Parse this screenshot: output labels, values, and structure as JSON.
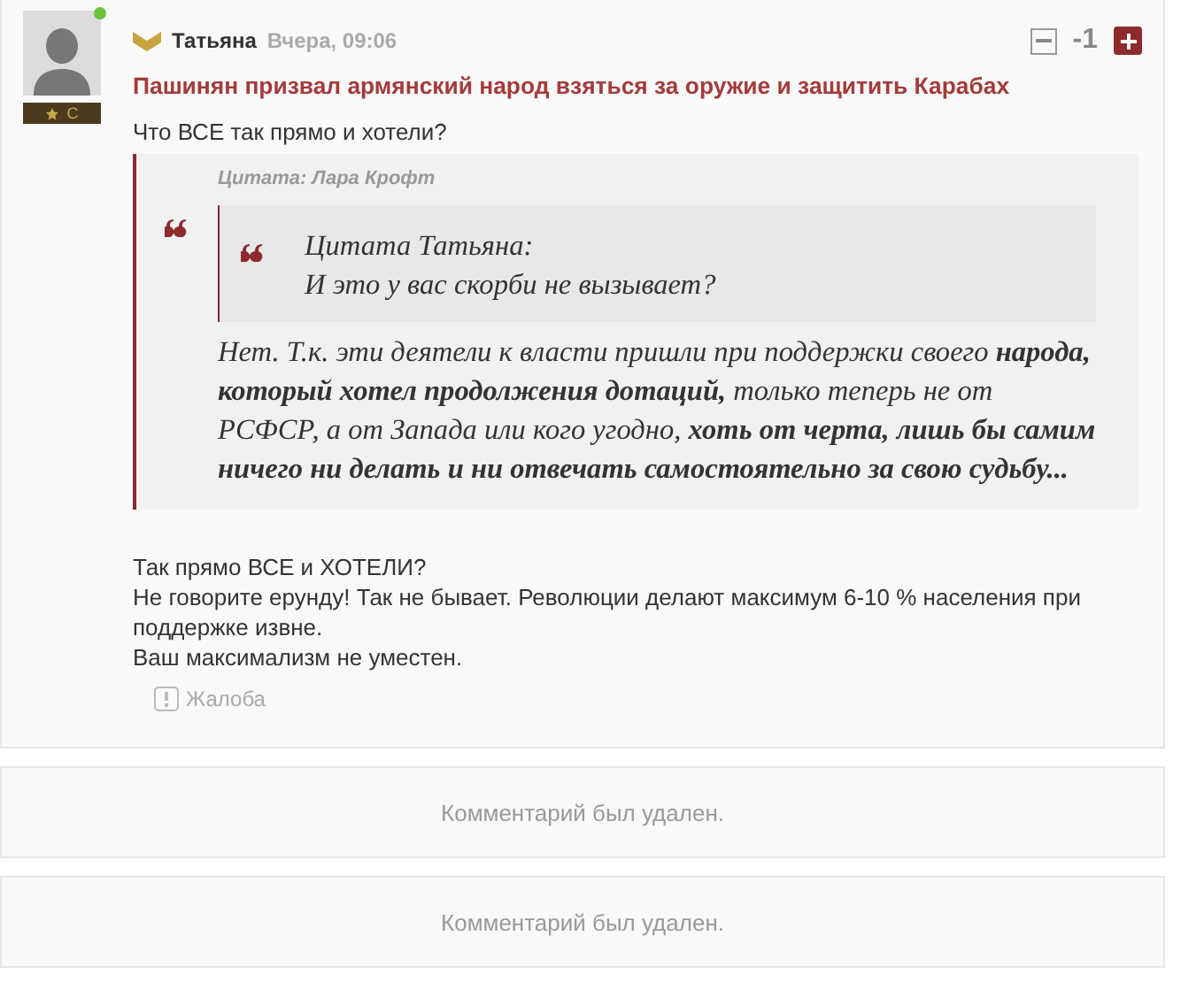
{
  "comment": {
    "author": "Татьяна",
    "time": "Вчера, 09:06",
    "online": true,
    "rank": "C",
    "score": "-1",
    "title": "Пашинян призвал армянский народ взяться за оружие и защитить Карабах",
    "intro": "Что ВСЕ так прямо и хотели?",
    "quote": {
      "header": "Цитата: Лара Крофт",
      "inner": {
        "author": "Цитата Татьяна:",
        "text": "И это у вас скорби не вызывает?"
      },
      "text": "Нет. Т.к. эти деятели к власти пришли при поддержки своего **народа, который хотел продолжения дотаций,** только теперь не от РСФСР, а от Запада или кого угодно, **хоть от черта, лишь бы самим ничего ни делать и ни отвечать самостоятельно за свою судьбу...**"
    },
    "reply": [
      "Так прямо ВСЕ и ХОТЕЛИ?",
      "Не говорите ерунду! Так не бывает. Революции делают максимум 6-10 % населения при поддержке извне.",
      "Ваш максимализм не уместен."
    ],
    "complaint": "Жалоба"
  },
  "deleted": [
    "Комментарий был удален.",
    "Комментарий был удален."
  ]
}
